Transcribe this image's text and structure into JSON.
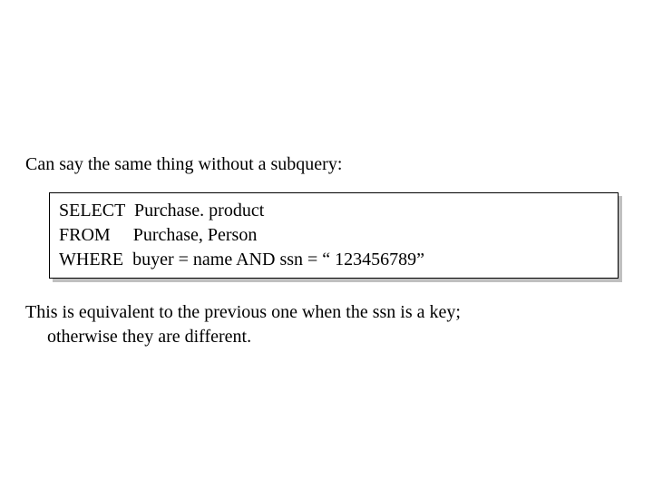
{
  "intro": "Can say the same thing without a subquery:",
  "code": {
    "line1": "SELECT  Purchase. product",
    "line2": "FROM     Purchase, Person",
    "line3": "WHERE  buyer = name AND ssn = “ 123456789”"
  },
  "outro": {
    "line1": "This is equivalent to the previous one when the ssn is a key;",
    "line2": "otherwise they are different."
  }
}
